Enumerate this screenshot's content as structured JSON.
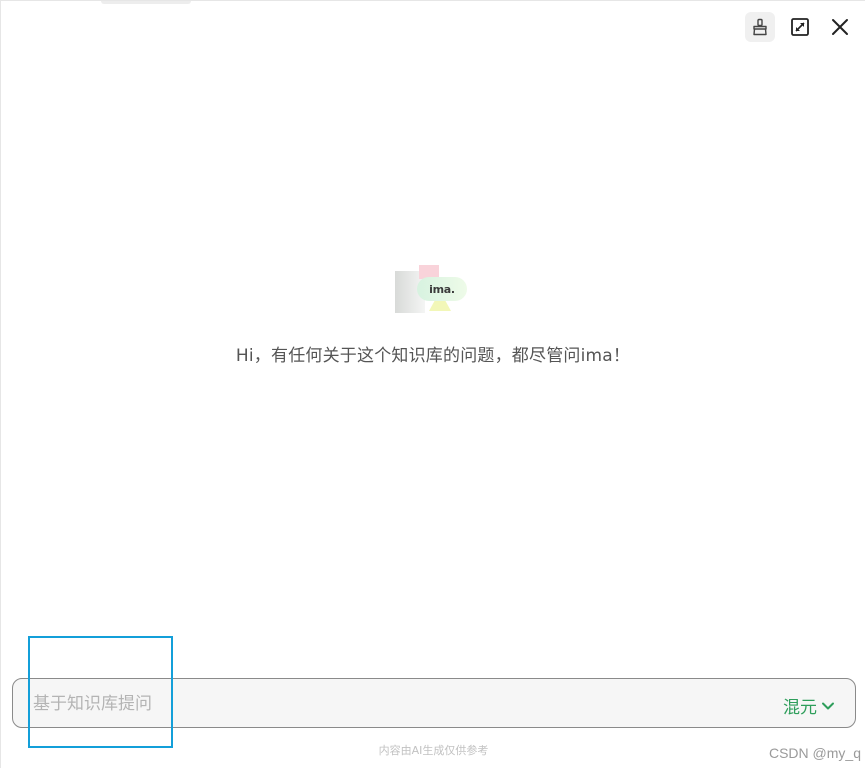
{
  "toolbar": {
    "clean_icon": "broom-icon",
    "expand_icon": "expand-icon",
    "close_icon": "close-icon"
  },
  "welcome": {
    "logo_text": "ima.",
    "greeting": "Hi，有任何关于这个知识库的问题，都尽管问ima！"
  },
  "input": {
    "placeholder": "基于知识库提问",
    "value": "",
    "model_label": "混元",
    "model_icon": "chevron-down-icon"
  },
  "footer": {
    "disclaimer": "内容由AI生成仅供参考",
    "watermark": "CSDN @my_q"
  },
  "colors": {
    "accent": "#2e9e5b",
    "highlight": "#139fd9"
  }
}
